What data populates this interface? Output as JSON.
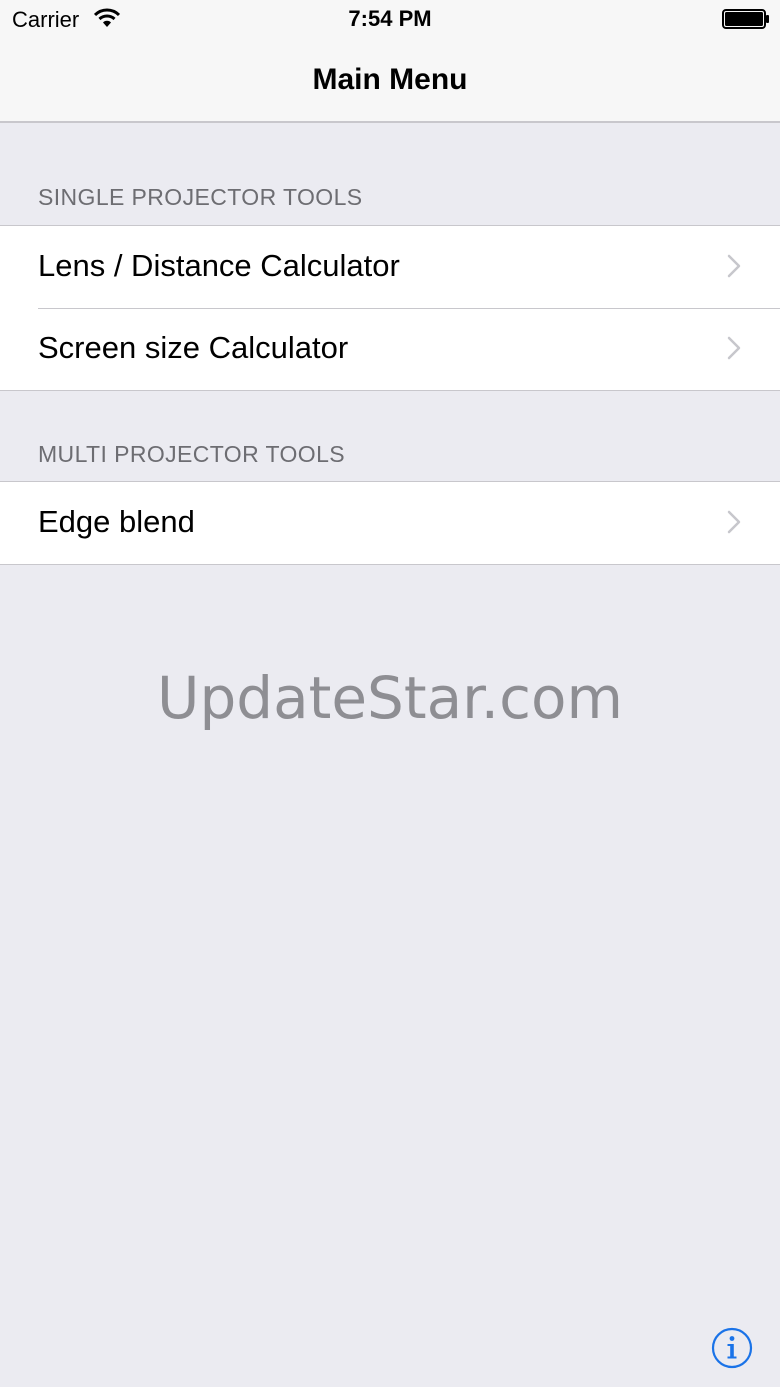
{
  "status_bar": {
    "carrier": "Carrier",
    "time": "7:54 PM",
    "wifi_icon": "wifi-icon",
    "battery_icon": "battery-icon"
  },
  "nav_bar": {
    "title": "Main Menu"
  },
  "sections": [
    {
      "header": "SINGLE PROJECTOR TOOLS",
      "items": [
        {
          "label": "Lens / Distance Calculator",
          "icon": "chevron-right-icon"
        },
        {
          "label": "Screen size Calculator",
          "icon": "chevron-right-icon"
        }
      ]
    },
    {
      "header": "MULTI PROJECTOR TOOLS",
      "items": [
        {
          "label": "Edge blend",
          "icon": "chevron-right-icon"
        }
      ]
    }
  ],
  "watermark": "UpdateStar.com",
  "info_button": {
    "icon": "info-icon"
  },
  "colors": {
    "background": "#ebebf1",
    "bar": "#f7f7f7",
    "section_header": "#6d6d72",
    "separator": "#c8c7cc",
    "chevron": "#c7c7cc",
    "accent": "#1a73e8"
  }
}
